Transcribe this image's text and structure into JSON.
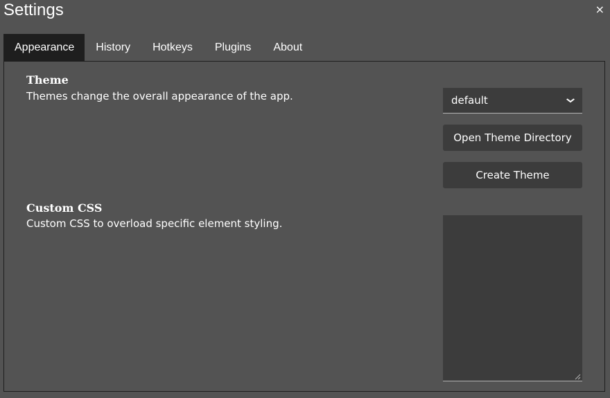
{
  "window": {
    "title": "Settings",
    "close_glyph": "×"
  },
  "tabs": [
    {
      "label": "Appearance",
      "active": true
    },
    {
      "label": "History",
      "active": false
    },
    {
      "label": "Hotkeys",
      "active": false
    },
    {
      "label": "Plugins",
      "active": false
    },
    {
      "label": "About",
      "active": false
    }
  ],
  "theme": {
    "title": "Theme",
    "description": "Themes change the overall appearance of the app.",
    "selected": "default",
    "open_dir_label": "Open Theme Directory",
    "create_label": "Create Theme"
  },
  "custom_css": {
    "title": "Custom CSS",
    "description": "Custom CSS to overload specific element styling.",
    "value": ""
  },
  "colors": {
    "background": "#535353",
    "tab_active": "#1e1e1e",
    "control": "#3c3c3c",
    "text": "#ffffff"
  }
}
